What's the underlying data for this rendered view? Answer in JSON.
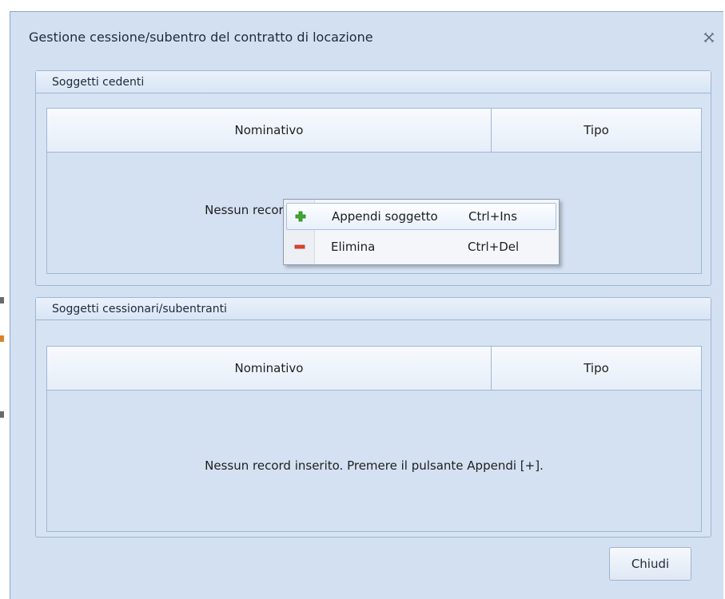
{
  "window": {
    "title": "Gestione cessione/subentro del contratto di locazione",
    "close_icon": "close-icon"
  },
  "groups": [
    {
      "header": "Soggetti cedenti",
      "columns": [
        "Nominativo",
        "Tipo"
      ],
      "empty_message": "Nessun record inserito. Premere il pulsante Appendi [+]."
    },
    {
      "header": "Soggetti cessionari/subentranti",
      "columns": [
        "Nominativo",
        "Tipo"
      ],
      "empty_message": "Nessun record inserito. Premere il pulsante Appendi [+]."
    }
  ],
  "context_menu": {
    "items": [
      {
        "label": "Appendi soggetto",
        "shortcut": "Ctrl+Ins",
        "icon": "plus-icon",
        "color": "#3caa2c"
      },
      {
        "label": "Elimina",
        "shortcut": "Ctrl+Del",
        "icon": "minus-icon",
        "color": "#e0452b"
      }
    ]
  },
  "footer": {
    "close_button": "Chiudi"
  },
  "colors": {
    "dialog_bg": "#d2e0f2",
    "border": "#9fb6d3"
  }
}
